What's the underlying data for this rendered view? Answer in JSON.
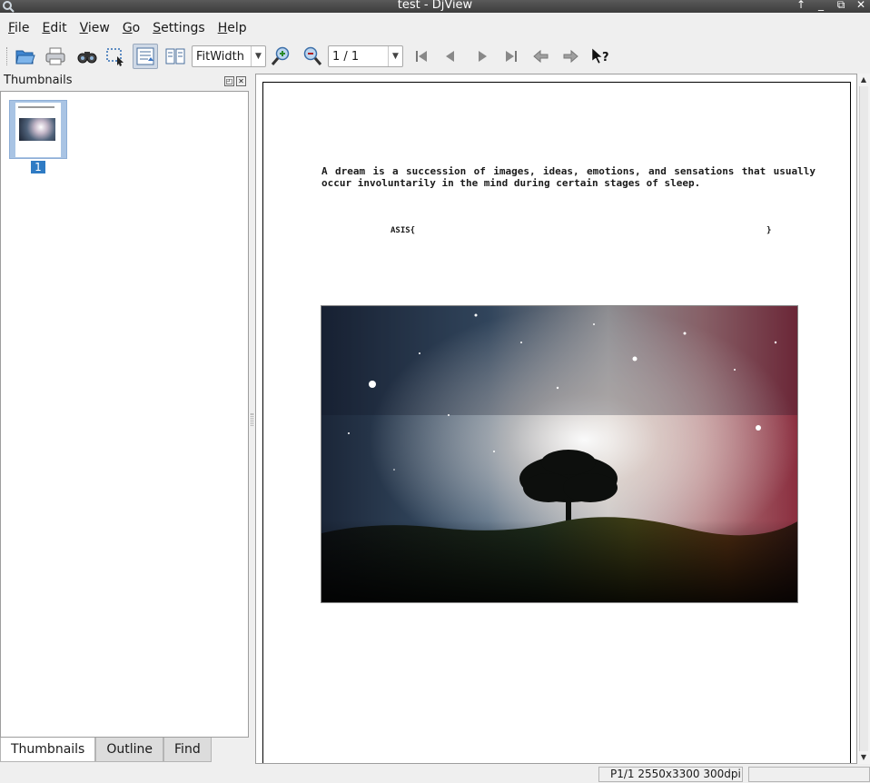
{
  "window": {
    "title": "test - DjView",
    "controls": [
      "↑",
      "_",
      "⧉",
      "✕"
    ]
  },
  "menubar": {
    "items": [
      {
        "label": "File",
        "mnemonic": "F"
      },
      {
        "label": "Edit",
        "mnemonic": "E"
      },
      {
        "label": "View",
        "mnemonic": "V"
      },
      {
        "label": "Go",
        "mnemonic": "G"
      },
      {
        "label": "Settings",
        "mnemonic": "S"
      },
      {
        "label": "Help",
        "mnemonic": "H"
      }
    ]
  },
  "toolbar": {
    "zoom_mode": "FitWidth",
    "page_indicator": "1 / 1",
    "icons": [
      "open-icon",
      "print-icon",
      "find-icon",
      "select-icon",
      "continuous-icon",
      "side-by-side-icon",
      "zoom-in-icon",
      "zoom-out-icon",
      "first-page-icon",
      "prev-page-icon",
      "next-page-icon",
      "last-page-icon",
      "back-icon",
      "forward-icon",
      "whats-this-icon"
    ]
  },
  "sidebar": {
    "title": "Thumbnails",
    "thumbnails": [
      {
        "page_number": "1"
      }
    ],
    "tabs": [
      "Thumbnails",
      "Outline",
      "Find"
    ],
    "active_tab": "Thumbnails"
  },
  "document": {
    "paragraph": "A dream is a succession of images, ideas, emotions, and sensations that usually occur involuntarily in the mind during certain stages of sleep.",
    "asis_open": "ASIS{",
    "asis_close": "}"
  },
  "status": {
    "page_info": "P1/1 2550x3300 300dpi",
    "extra": ""
  },
  "colors": {
    "accent": "#2f7bc4",
    "thumb_bg": "#a9c4e4"
  }
}
